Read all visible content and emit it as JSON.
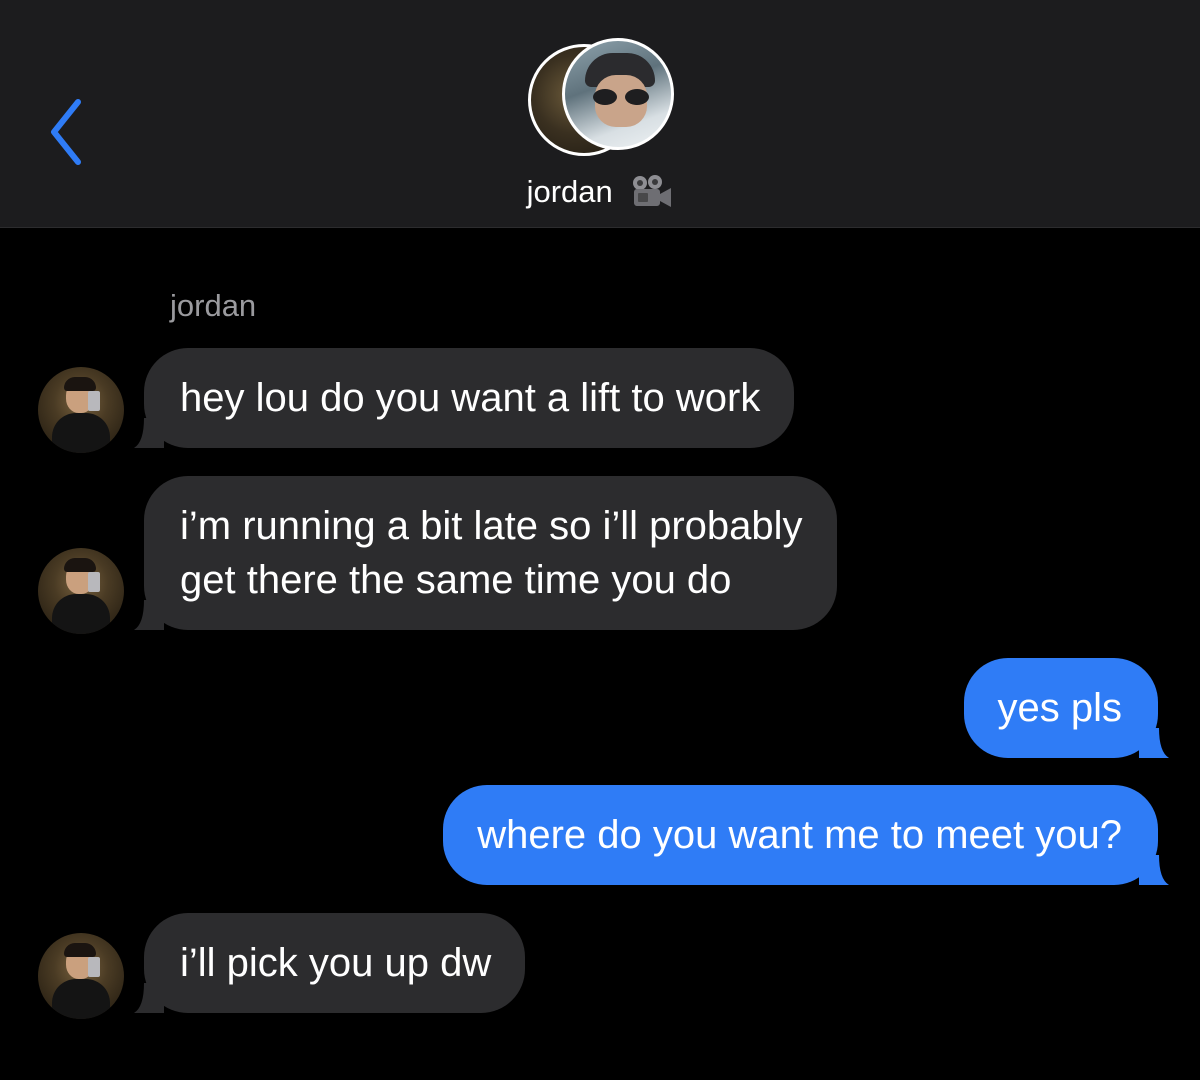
{
  "header": {
    "back_icon": "chevron-left-icon",
    "contact_name": "jordan",
    "video_icon": "video-camera-icon",
    "accent_color": "#2f7cf6"
  },
  "thread": {
    "sender_label": "jordan",
    "messages": [
      {
        "from": "jordan",
        "lines": [
          "hey lou do you want a lift to work"
        ]
      },
      {
        "from": "jordan",
        "lines": [
          "i’m running a bit late so i’ll probably",
          "get there the same time you do"
        ]
      },
      {
        "from": "me",
        "lines": [
          "yes pls"
        ]
      },
      {
        "from": "me",
        "lines": [
          "where do you want me to meet you?"
        ]
      },
      {
        "from": "jordan",
        "lines": [
          "i’ll pick you up dw"
        ]
      }
    ]
  },
  "colors": {
    "background": "#000000",
    "header_background": "#1c1c1e",
    "incoming_bubble": "#2c2c2e",
    "outgoing_bubble": "#2f7cf6",
    "sender_label": "#9a9a9e"
  }
}
